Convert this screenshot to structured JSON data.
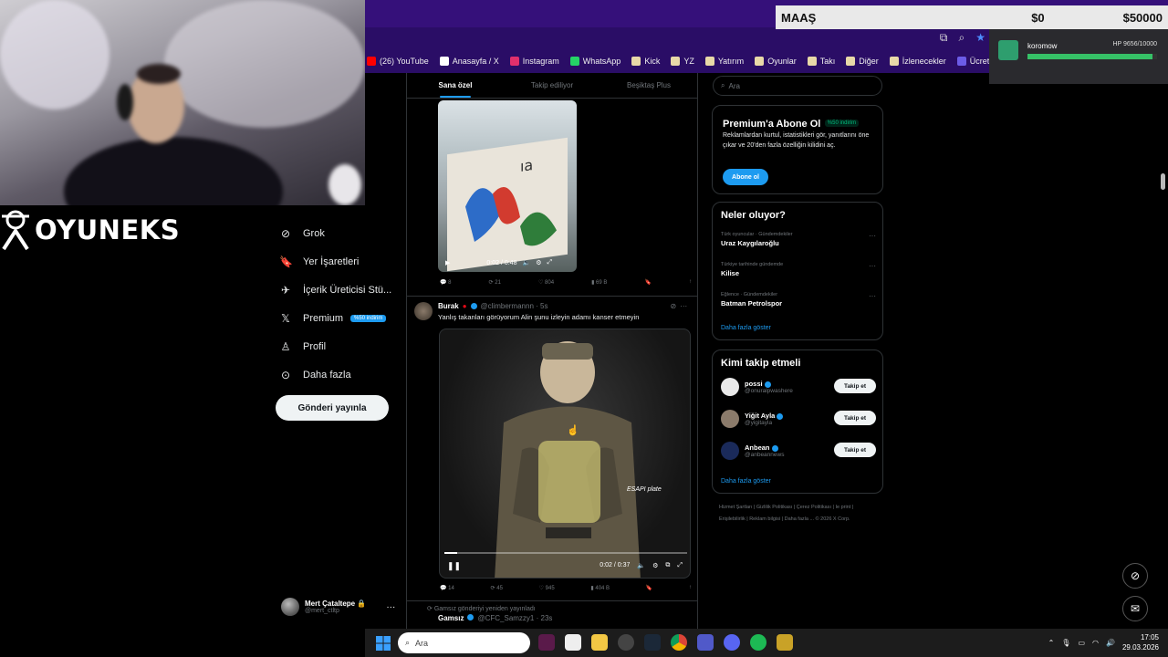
{
  "overlay": {
    "maas_label": "MAAŞ",
    "maas_current": "$0",
    "maas_target": "$50000",
    "viewer_name": "koromow",
    "viewer_hp": "HP 9656/10000",
    "viewer_hp_fraction": 0.9656,
    "brand": "OYUNEKS"
  },
  "bookmarks": [
    {
      "label": "(26) YouTube",
      "color": "#ff0000"
    },
    {
      "label": "Anasayfa / X",
      "color": "#ffffff"
    },
    {
      "label": "Instagram",
      "color": "#e1306c"
    },
    {
      "label": "WhatsApp",
      "color": "#25d366"
    },
    {
      "label": "Kick",
      "color": "#e8d9a8"
    },
    {
      "label": "YZ",
      "color": "#e8d9a8"
    },
    {
      "label": "Yatırım",
      "color": "#e8d9a8"
    },
    {
      "label": "Oyunlar",
      "color": "#e8d9a8"
    },
    {
      "label": "Takı",
      "color": "#e8d9a8"
    },
    {
      "label": "Diğer",
      "color": "#e8d9a8"
    },
    {
      "label": "İzlenecekler",
      "color": "#e8d9a8"
    },
    {
      "label": "Ücretsiz Online Resi...",
      "color": "#6c5ce7"
    }
  ],
  "nav": {
    "items": [
      {
        "label": "Grok",
        "icon": "grok-icon"
      },
      {
        "label": "Yer İşaretleri",
        "icon": "bookmark-icon"
      },
      {
        "label": "İçerik Üreticisi Stü...",
        "icon": "rocket-icon"
      },
      {
        "label": "Premium",
        "icon": "x-logo-icon"
      },
      {
        "label": "Profil",
        "icon": "person-icon"
      },
      {
        "label": "Daha fazla",
        "icon": "more-circle-icon"
      }
    ],
    "premium_badge": "%50 indirim",
    "post_button": "Gönderi yayınla",
    "profile_name": "Mert Çataltepe",
    "profile_handle": "@mert_ctltp"
  },
  "feed": {
    "tabs": [
      "Sana özel",
      "Takip ediliyor",
      "Beşiktaş Plus"
    ],
    "video1": {
      "time": "0:02 / 0:48",
      "replies": "8",
      "reposts": "21",
      "likes": "804",
      "views": "69 B"
    },
    "tweet2": {
      "name": "Burak",
      "handle": "@climbermannn · 5s",
      "text": "Yanlış takanları görüyorum Alin şunu izleyin adamı kanser etmeyin",
      "time": "0:02 / 0:37",
      "progress": 0.054,
      "overlay_label": "ESAPI plate",
      "replies": "14",
      "reposts": "45",
      "likes": "945",
      "views": "404 B"
    },
    "retweet_note": "Gamsız gönderiyi yeniden yayınladı",
    "tweet3": {
      "name": "Gamsız",
      "handle": "@CFC_Samzzy1 · 23s"
    }
  },
  "right": {
    "search_placeholder": "Ara",
    "premium": {
      "title": "Premium'a Abone Ol",
      "badge": "%50 indirim",
      "desc": "Reklamlardan kurtul, istatistikleri gör, yanıtlarını öne çıkar ve 20'den fazla özelliğin kilidini aç.",
      "button": "Abone ol"
    },
    "trends_title": "Neler oluyor?",
    "trends": [
      {
        "meta": "Türk oyuncular · Gündemdekiler",
        "name": "Uraz Kaygılaroğlu"
      },
      {
        "meta": "Türkiye tarihinde gündemde",
        "name": "Kilise"
      },
      {
        "meta": "Eğlence · Gündemdekiler",
        "name": "Batman Petrolspor"
      }
    ],
    "show_more": "Daha fazla göster",
    "follow_title": "Kimi takip etmeli",
    "follow": [
      {
        "name": "possi",
        "handle": "@onuralpwashere",
        "button": "Takip et",
        "color": "#e9e9e9"
      },
      {
        "name": "Yiğit Ayla",
        "handle": "@yigitayla",
        "button": "Takip et",
        "color": "#8b7b6b"
      },
      {
        "name": "Anbean",
        "handle": "@anbeannews",
        "button": "Takip et",
        "color": "#1a2a5a"
      }
    ],
    "footer": "Hizmet Şartları | Gizlilik Politikası | Çerez Politikası | Ie print | Erişilebilirlik | Reklam bilgisi | Daha fazla ... © 2026 X Corp."
  },
  "taskbar": {
    "search": "Ara",
    "time": "17:05",
    "date": "29.03.2026"
  }
}
